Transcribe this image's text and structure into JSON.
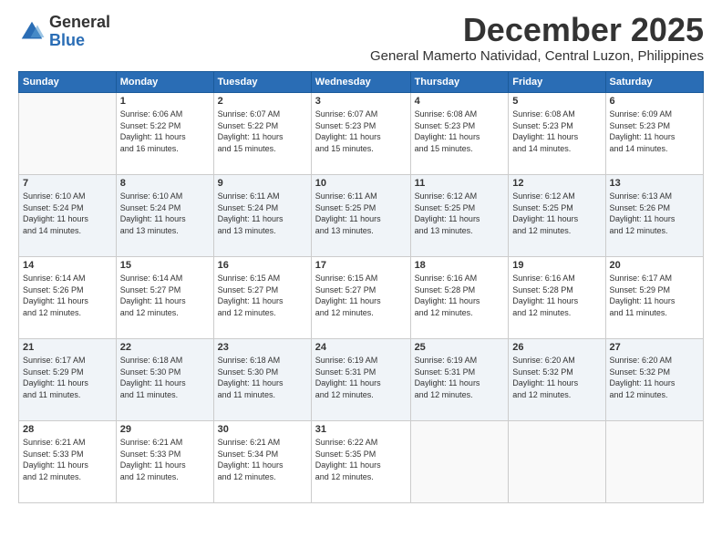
{
  "header": {
    "logo": {
      "general": "General",
      "blue": "Blue"
    },
    "month": "December 2025",
    "location": "General Mamerto Natividad, Central Luzon, Philippines"
  },
  "days_of_week": [
    "Sunday",
    "Monday",
    "Tuesday",
    "Wednesday",
    "Thursday",
    "Friday",
    "Saturday"
  ],
  "weeks": [
    [
      {
        "day": "",
        "info": ""
      },
      {
        "day": "1",
        "info": "Sunrise: 6:06 AM\nSunset: 5:22 PM\nDaylight: 11 hours\nand 16 minutes."
      },
      {
        "day": "2",
        "info": "Sunrise: 6:07 AM\nSunset: 5:22 PM\nDaylight: 11 hours\nand 15 minutes."
      },
      {
        "day": "3",
        "info": "Sunrise: 6:07 AM\nSunset: 5:23 PM\nDaylight: 11 hours\nand 15 minutes."
      },
      {
        "day": "4",
        "info": "Sunrise: 6:08 AM\nSunset: 5:23 PM\nDaylight: 11 hours\nand 15 minutes."
      },
      {
        "day": "5",
        "info": "Sunrise: 6:08 AM\nSunset: 5:23 PM\nDaylight: 11 hours\nand 14 minutes."
      },
      {
        "day": "6",
        "info": "Sunrise: 6:09 AM\nSunset: 5:23 PM\nDaylight: 11 hours\nand 14 minutes."
      }
    ],
    [
      {
        "day": "7",
        "info": "Sunrise: 6:10 AM\nSunset: 5:24 PM\nDaylight: 11 hours\nand 14 minutes."
      },
      {
        "day": "8",
        "info": "Sunrise: 6:10 AM\nSunset: 5:24 PM\nDaylight: 11 hours\nand 13 minutes."
      },
      {
        "day": "9",
        "info": "Sunrise: 6:11 AM\nSunset: 5:24 PM\nDaylight: 11 hours\nand 13 minutes."
      },
      {
        "day": "10",
        "info": "Sunrise: 6:11 AM\nSunset: 5:25 PM\nDaylight: 11 hours\nand 13 minutes."
      },
      {
        "day": "11",
        "info": "Sunrise: 6:12 AM\nSunset: 5:25 PM\nDaylight: 11 hours\nand 13 minutes."
      },
      {
        "day": "12",
        "info": "Sunrise: 6:12 AM\nSunset: 5:25 PM\nDaylight: 11 hours\nand 12 minutes."
      },
      {
        "day": "13",
        "info": "Sunrise: 6:13 AM\nSunset: 5:26 PM\nDaylight: 11 hours\nand 12 minutes."
      }
    ],
    [
      {
        "day": "14",
        "info": "Sunrise: 6:14 AM\nSunset: 5:26 PM\nDaylight: 11 hours\nand 12 minutes."
      },
      {
        "day": "15",
        "info": "Sunrise: 6:14 AM\nSunset: 5:27 PM\nDaylight: 11 hours\nand 12 minutes."
      },
      {
        "day": "16",
        "info": "Sunrise: 6:15 AM\nSunset: 5:27 PM\nDaylight: 11 hours\nand 12 minutes."
      },
      {
        "day": "17",
        "info": "Sunrise: 6:15 AM\nSunset: 5:27 PM\nDaylight: 11 hours\nand 12 minutes."
      },
      {
        "day": "18",
        "info": "Sunrise: 6:16 AM\nSunset: 5:28 PM\nDaylight: 11 hours\nand 12 minutes."
      },
      {
        "day": "19",
        "info": "Sunrise: 6:16 AM\nSunset: 5:28 PM\nDaylight: 11 hours\nand 12 minutes."
      },
      {
        "day": "20",
        "info": "Sunrise: 6:17 AM\nSunset: 5:29 PM\nDaylight: 11 hours\nand 11 minutes."
      }
    ],
    [
      {
        "day": "21",
        "info": "Sunrise: 6:17 AM\nSunset: 5:29 PM\nDaylight: 11 hours\nand 11 minutes."
      },
      {
        "day": "22",
        "info": "Sunrise: 6:18 AM\nSunset: 5:30 PM\nDaylight: 11 hours\nand 11 minutes."
      },
      {
        "day": "23",
        "info": "Sunrise: 6:18 AM\nSunset: 5:30 PM\nDaylight: 11 hours\nand 11 minutes."
      },
      {
        "day": "24",
        "info": "Sunrise: 6:19 AM\nSunset: 5:31 PM\nDaylight: 11 hours\nand 12 minutes."
      },
      {
        "day": "25",
        "info": "Sunrise: 6:19 AM\nSunset: 5:31 PM\nDaylight: 11 hours\nand 12 minutes."
      },
      {
        "day": "26",
        "info": "Sunrise: 6:20 AM\nSunset: 5:32 PM\nDaylight: 11 hours\nand 12 minutes."
      },
      {
        "day": "27",
        "info": "Sunrise: 6:20 AM\nSunset: 5:32 PM\nDaylight: 11 hours\nand 12 minutes."
      }
    ],
    [
      {
        "day": "28",
        "info": "Sunrise: 6:21 AM\nSunset: 5:33 PM\nDaylight: 11 hours\nand 12 minutes."
      },
      {
        "day": "29",
        "info": "Sunrise: 6:21 AM\nSunset: 5:33 PM\nDaylight: 11 hours\nand 12 minutes."
      },
      {
        "day": "30",
        "info": "Sunrise: 6:21 AM\nSunset: 5:34 PM\nDaylight: 11 hours\nand 12 minutes."
      },
      {
        "day": "31",
        "info": "Sunrise: 6:22 AM\nSunset: 5:35 PM\nDaylight: 11 hours\nand 12 minutes."
      },
      {
        "day": "",
        "info": ""
      },
      {
        "day": "",
        "info": ""
      },
      {
        "day": "",
        "info": ""
      }
    ]
  ]
}
